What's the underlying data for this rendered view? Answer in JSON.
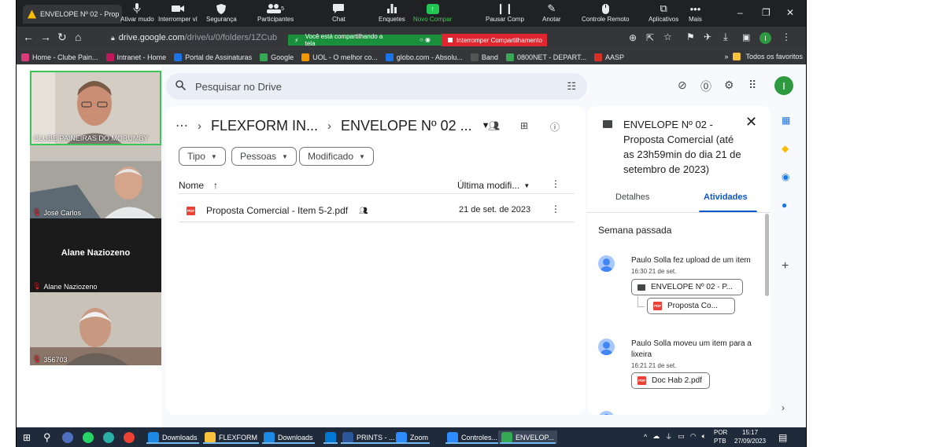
{
  "browser": {
    "tab_title": "ENVELOPE Nº 02 - Prop",
    "url_host": "drive.google.com",
    "url_path": "/drive/u/0/folders/1ZCub",
    "window_controls": [
      "–",
      "❐",
      "✕"
    ]
  },
  "zoom_toolbar": {
    "mute": "Ativar mudo",
    "stop_video": "Interromper ví",
    "security": "Segurança",
    "participants": "Participantes",
    "participants_count": "5",
    "chat": "Chat",
    "polls": "Enquetes",
    "new_share": "Novo Compar",
    "pause_share": "Pausar Comp",
    "annotate": "Anotar",
    "remote_control": "Controle Remoto",
    "apps": "Aplicativos",
    "more": "Mais",
    "sharing_banner": "Você está compartilhando a tela",
    "stop_share": "Interromper Compartilhamento"
  },
  "bookmarks": {
    "items": [
      {
        "label": "Home - Clube Pain...",
        "color": "#d93b7b"
      },
      {
        "label": "Intranet - Home",
        "color": "#c2185b"
      },
      {
        "label": "Portal de Assinaturas",
        "color": "#1a73e8"
      },
      {
        "label": "Google",
        "color": "#34a853"
      },
      {
        "label": "UOL - O melhor co...",
        "color": "#f29900"
      },
      {
        "label": "globo.com - Absolu...",
        "color": "#1a73e8"
      },
      {
        "label": "Band",
        "color": "#555"
      },
      {
        "label": "0800NET - DEPART...",
        "color": "#3aa757"
      },
      {
        "label": "AASP",
        "color": "#d93025"
      }
    ],
    "all_bookmarks": "Todos os favoritos"
  },
  "videos": [
    {
      "name": "CLUBE PAINEIRAS DO MORUMBY",
      "muted": false
    },
    {
      "name": "José Carlos",
      "muted": true
    },
    {
      "name": "Alane Naziozeno",
      "muted": true,
      "center_label": "Alane Naziozeno"
    },
    {
      "name": "356703",
      "muted": true
    }
  ],
  "drive": {
    "search_placeholder": "Pesquisar no Drive",
    "breadcrumb": [
      "FLEXFORM IN...",
      "ENVELOPE Nº 02 ..."
    ],
    "filters": [
      "Tipo",
      "Pessoas",
      "Modificado"
    ],
    "columns": {
      "name": "Nome",
      "modified": "Última modifi..."
    },
    "files": [
      {
        "name": "Proposta Comercial - Item 5-2.pdf",
        "modified": "21 de set. de 2023",
        "shared": true
      }
    ],
    "user_initial": "I"
  },
  "details": {
    "title": "ENVELOPE Nº 02 - Proposta Comercial (até as 23h59min do dia 21 de setembro de 2023)",
    "tabs": [
      "Detalhes",
      "Atividades"
    ],
    "active_tab": "Atividades",
    "week_label": "Semana passada",
    "activities": [
      {
        "text": "Paulo Solla fez upload de um item",
        "time": "16:30 21 de set.",
        "items": [
          "ENVELOPE Nº 02 - P...",
          "Proposta Co..."
        ]
      },
      {
        "text": "Paulo Solla moveu um item para a lixeira",
        "time": "16:21 21 de set.",
        "items": [
          "Doc Hab 2.pdf"
        ]
      }
    ]
  },
  "taskbar": {
    "items": [
      {
        "label": "Downloads",
        "color": "#1e88e5"
      },
      {
        "label": "FLEXFORM",
        "color": "#f9c23c"
      },
      {
        "label": "Downloads",
        "color": "#1e88e5"
      },
      {
        "label": "",
        "color": "#0078d4"
      },
      {
        "label": "PRINTS - ...",
        "color": "#2b579a"
      },
      {
        "label": "Zoom",
        "color": "#2d8cff"
      },
      {
        "label": "Controles...",
        "color": "#2d8cff"
      },
      {
        "label": "ENVELOP...",
        "color": "#34a853"
      }
    ],
    "lang": "POR",
    "lang2": "PTB",
    "time": "15:17",
    "date": "27/09/2023"
  }
}
